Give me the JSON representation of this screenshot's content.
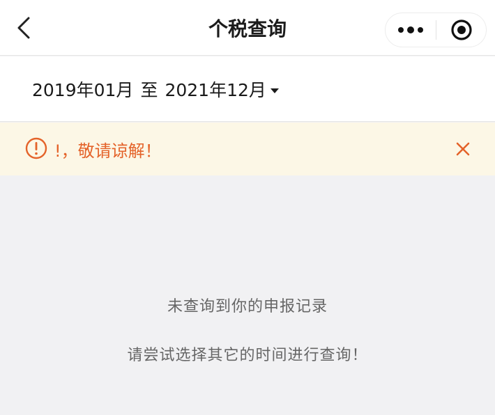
{
  "navbar": {
    "title": "个税查询",
    "back_icon": "chevron-left-icon",
    "more_icon": "more-dots-icon",
    "close_icon": "target-circle-icon"
  },
  "date_filter": {
    "start": "2019年01月",
    "separator": "至",
    "end": "2021年12月",
    "dropdown_icon": "caret-down-icon"
  },
  "notice": {
    "text": "!，敬请谅解！",
    "icon": "exclamation-circle-icon",
    "close_icon": "close-x-icon",
    "accent_color": "#e4632a",
    "background_color": "#fcf7e6"
  },
  "empty_state": {
    "line1": "未查询到你的申报记录",
    "line2": "请尝试选择其它的时间进行查询！"
  }
}
